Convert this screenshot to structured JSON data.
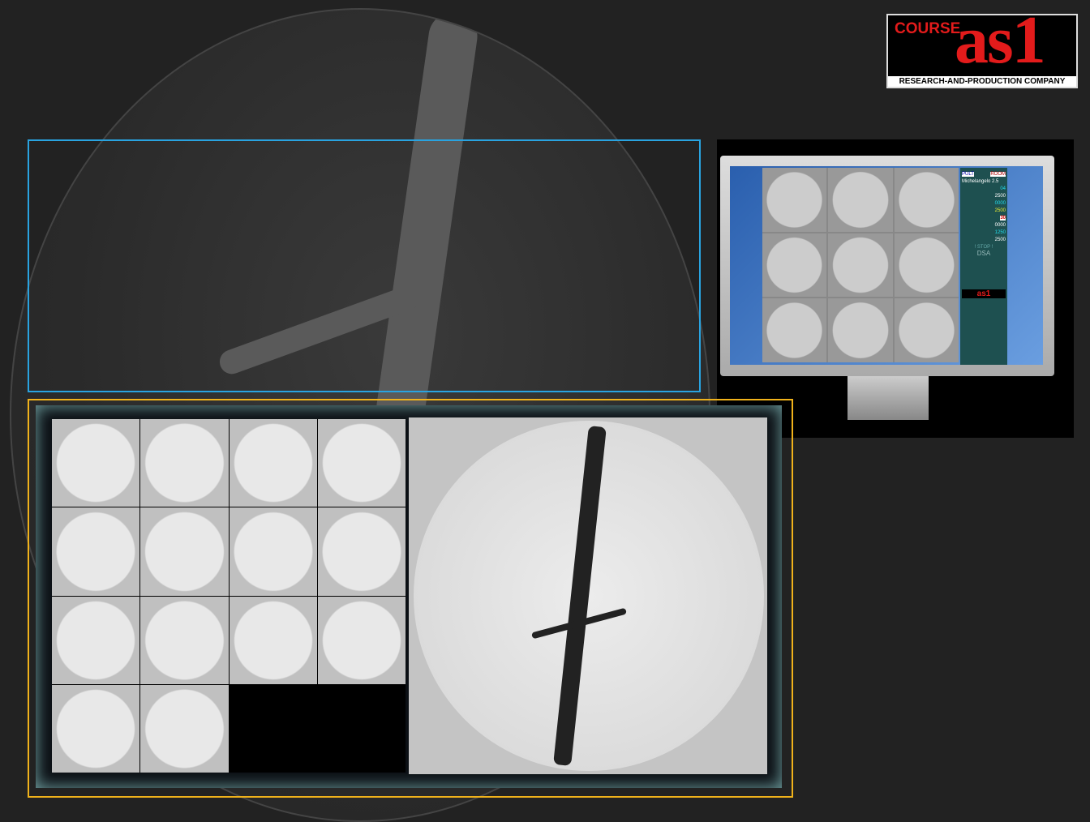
{
  "logo": {
    "course": "COURSE",
    "brand": "as1",
    "tagline": "RESEARCH-AND-PRODUCTION COMPANY"
  },
  "monitor_panel": {
    "buttons": [
      "PULT",
      "ROOM"
    ],
    "title": "Michelangelo 2.5",
    "values": [
      "04",
      "2500",
      "0000",
      "2500"
    ],
    "frame_rate": "30",
    "counters": [
      "0000",
      "1250",
      "2500"
    ],
    "stop": "! STOP !",
    "mode": "DSA",
    "footer_logo": "as1"
  },
  "colors": {
    "highlight_blue": "#29a3e0",
    "highlight_orange": "#f0b21b",
    "brand_red": "#e31b1b"
  }
}
